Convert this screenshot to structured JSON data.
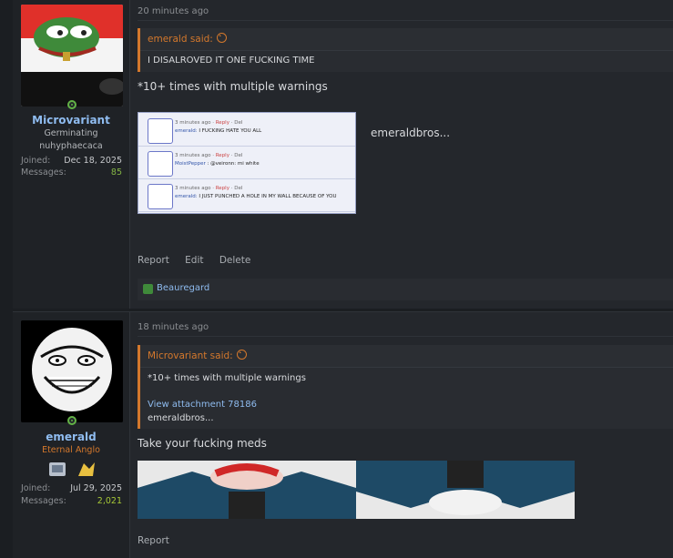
{
  "posts": [
    {
      "user": {
        "name": "Microvariant",
        "title_line1": "Germinating",
        "title_line2": "nuhyphaecaca"
      },
      "stats": {
        "joined_label": "Joined:",
        "joined_value": "Dec 18, 2025",
        "messages_label": "Messages:",
        "messages_value": "85"
      },
      "time": "20 minutes ago",
      "quote": {
        "header": "emerald said:",
        "text": "I DISALROVED IT ONE FUCKING TIME"
      },
      "body": "*10+ times with multiple warnings",
      "attachment": {
        "rows": [
          {
            "meta_time": "3 minutes ago · ",
            "meta_reply": "Reply",
            "meta_del": " · Del",
            "author": "emerald:",
            "text": " I FUCKING HATE YOU ALL"
          },
          {
            "meta_time": "3 minutes ago · ",
            "meta_reply": "Reply",
            "meta_del": " · Del",
            "author": "MoistPepper",
            "text": " : @veironn: mi white"
          },
          {
            "meta_time": "3 minutes ago · ",
            "meta_reply": "Reply",
            "meta_del": " · Del",
            "author": "emerald:",
            "text": " I JUST PUNCHED A HOLE IN MY WALL BECAUSE OF YOU"
          }
        ]
      },
      "side_text": "emeraldbros...",
      "actions": {
        "report": "Report",
        "edit": "Edit",
        "delete": "Delete"
      },
      "reaction_user": "Beauregard"
    },
    {
      "user": {
        "name": "emerald",
        "title_line1": "Eternal Anglo"
      },
      "stats": {
        "joined_label": "Joined:",
        "joined_value": "Jul 29, 2025",
        "messages_label": "Messages:",
        "messages_value": "2,021"
      },
      "time": "18 minutes ago",
      "quote": {
        "header": "Microvariant said:",
        "text": "*10+ times with multiple warnings",
        "link": "View attachment 78186",
        "text2": "emeraldbros..."
      },
      "body": "Take your fucking meds",
      "actions": {
        "report": "Report"
      }
    }
  ],
  "colors": {
    "accent": "#d4782c",
    "link": "#8fbcf0",
    "online": "#63b347"
  },
  "icons": [
    "online-status-icon",
    "quote-jump-icon",
    "reaction-icon"
  ]
}
